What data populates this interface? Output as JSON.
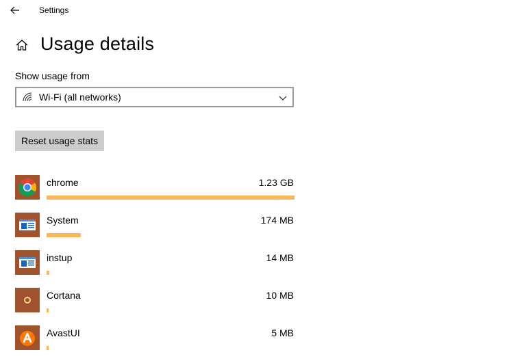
{
  "window": {
    "title": "Settings"
  },
  "page": {
    "title": "Usage details"
  },
  "usage_from": {
    "label": "Show usage from",
    "selected": "Wi-Fi (all networks)"
  },
  "reset_button": {
    "label": "Reset usage stats"
  },
  "colors": {
    "bar": "#f9b95a",
    "icon_bg": "#a0522d",
    "button_bg": "#cccccc"
  },
  "apps": [
    {
      "name": "chrome",
      "size": "1.23 GB",
      "usage_fraction": 1.0,
      "icon": "chrome-icon"
    },
    {
      "name": "System",
      "size": "174 MB",
      "usage_fraction": 0.138,
      "icon": "system-app-icon"
    },
    {
      "name": "instup",
      "size": "14 MB",
      "usage_fraction": 0.011,
      "icon": "system-app-icon"
    },
    {
      "name": "Cortana",
      "size": "10 MB",
      "usage_fraction": 0.008,
      "icon": "cortana-icon"
    },
    {
      "name": "AvastUI",
      "size": "5 MB",
      "usage_fraction": 0.004,
      "icon": "avast-icon"
    }
  ]
}
